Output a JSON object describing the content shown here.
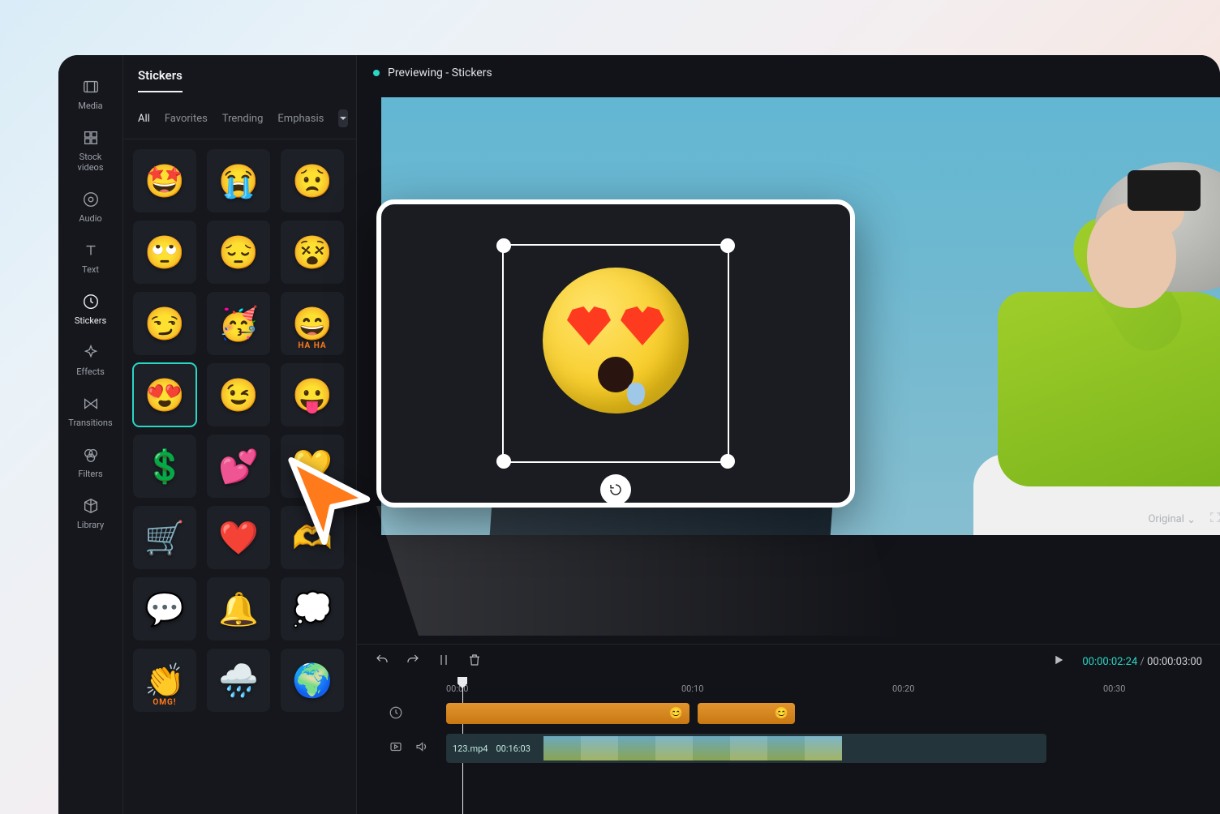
{
  "rail": [
    {
      "id": "media",
      "label": "Media"
    },
    {
      "id": "stock",
      "label": "Stock videos"
    },
    {
      "id": "audio",
      "label": "Audio"
    },
    {
      "id": "text",
      "label": "Text"
    },
    {
      "id": "stickers",
      "label": "Stickers"
    },
    {
      "id": "effects",
      "label": "Effects"
    },
    {
      "id": "transitions",
      "label": "Transitions"
    },
    {
      "id": "filters",
      "label": "Filters"
    },
    {
      "id": "library",
      "label": "Library"
    }
  ],
  "rail_active": "stickers",
  "panel": {
    "title": "Stickers",
    "tabs": [
      "All",
      "Favorites",
      "Trending",
      "Emphasis"
    ],
    "active_tab": "All"
  },
  "stickers": [
    {
      "id": "star-eyes",
      "glyph": "🤩"
    },
    {
      "id": "crying",
      "glyph": "😭"
    },
    {
      "id": "worried",
      "glyph": "😟"
    },
    {
      "id": "eye-roll",
      "glyph": "🙄"
    },
    {
      "id": "pensive",
      "glyph": "😔"
    },
    {
      "id": "dizzy",
      "glyph": "😵"
    },
    {
      "id": "smirk",
      "glyph": "😏"
    },
    {
      "id": "party",
      "glyph": "🥳"
    },
    {
      "id": "haha",
      "glyph": "😄",
      "badge": "HA HA"
    },
    {
      "id": "heart-eyes",
      "glyph": "😍",
      "selected": true
    },
    {
      "id": "wink",
      "glyph": "😉"
    },
    {
      "id": "tongue",
      "glyph": "😛"
    },
    {
      "id": "dollar",
      "glyph": "💲"
    },
    {
      "id": "sparkle-hearts",
      "glyph": "💕"
    },
    {
      "id": "tiny-hearts",
      "glyph": "💛"
    },
    {
      "id": "cart",
      "glyph": "🛒"
    },
    {
      "id": "hearts-cluster",
      "glyph": "❤️"
    },
    {
      "id": "heart-hands",
      "glyph": "🫶"
    },
    {
      "id": "bag-bubble",
      "glyph": "💬"
    },
    {
      "id": "bell",
      "glyph": "🔔"
    },
    {
      "id": "thought-heart",
      "glyph": "💭"
    },
    {
      "id": "omg",
      "glyph": "👏",
      "badge": "OMG!"
    },
    {
      "id": "rain-cloud",
      "glyph": "🌧️"
    },
    {
      "id": "earth",
      "glyph": "🌍"
    }
  ],
  "preview": {
    "status": "Previewing - Stickers",
    "aspect_label": "Original"
  },
  "timeline": {
    "current": "00:00:02:24",
    "total": "00:00:03:00",
    "ticks": [
      "00:00",
      "00:10",
      "00:20",
      "00:30"
    ],
    "video": {
      "name": "123.mp4",
      "duration": "00:16:03"
    }
  },
  "colors": {
    "accent": "#2bd6c4",
    "clip": "#d88a24"
  }
}
